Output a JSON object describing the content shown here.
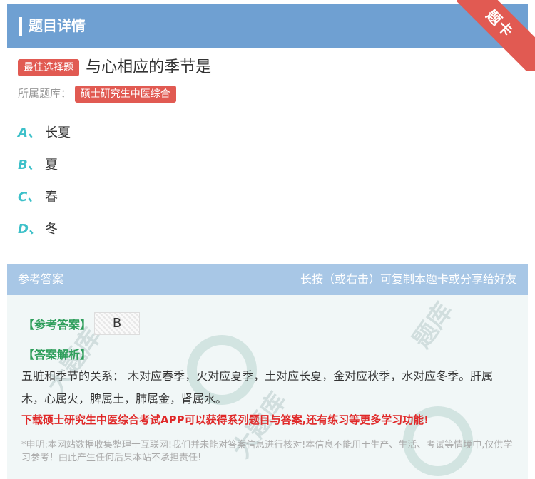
{
  "header": {
    "title": "题目详情"
  },
  "ribbon": {
    "label": "题卡"
  },
  "question": {
    "type_tag": "最佳选择题",
    "text": "与心相应的季节是",
    "bank_label": "所属题库：",
    "bank_name": "硕士研究生中医综合"
  },
  "options": [
    {
      "letter": "A、",
      "text": "长夏"
    },
    {
      "letter": "B、",
      "text": "夏"
    },
    {
      "letter": "C、",
      "text": "春"
    },
    {
      "letter": "D、",
      "text": "冬"
    }
  ],
  "answer": {
    "head_left": "参考答案",
    "head_right": "长按（或右击）可复制本题卡或分享给好友",
    "answer_label": "【参考答案】",
    "answer_value": "B",
    "analysis_label": "【答案解析】",
    "analysis_text": "五脏和季节的关系： 木对应春季，火对应夏季，土对应长夏，金对应秋季，水对应冬季。肝属木，心属火，脾属土，肺属金，肾属水。",
    "promo": "下载硕士研究生中医综合考试APP可以获得系列题目与答案,还有练习等更多学习功能!",
    "disclaimer": "*申明:本网站数据收集整理于互联网!我们并未能对答案信息进行核对!本信息不能用于生产、生活、考试等情境中,仅供学习参考！由此产生任何后果本站不承担责任!"
  },
  "colors": {
    "header_bg": "#6fa0d2",
    "tag_red": "#e15a52",
    "option_letter": "#3cc0c9",
    "answer_green": "#2e9e5b",
    "promo_red": "#e02828"
  }
}
